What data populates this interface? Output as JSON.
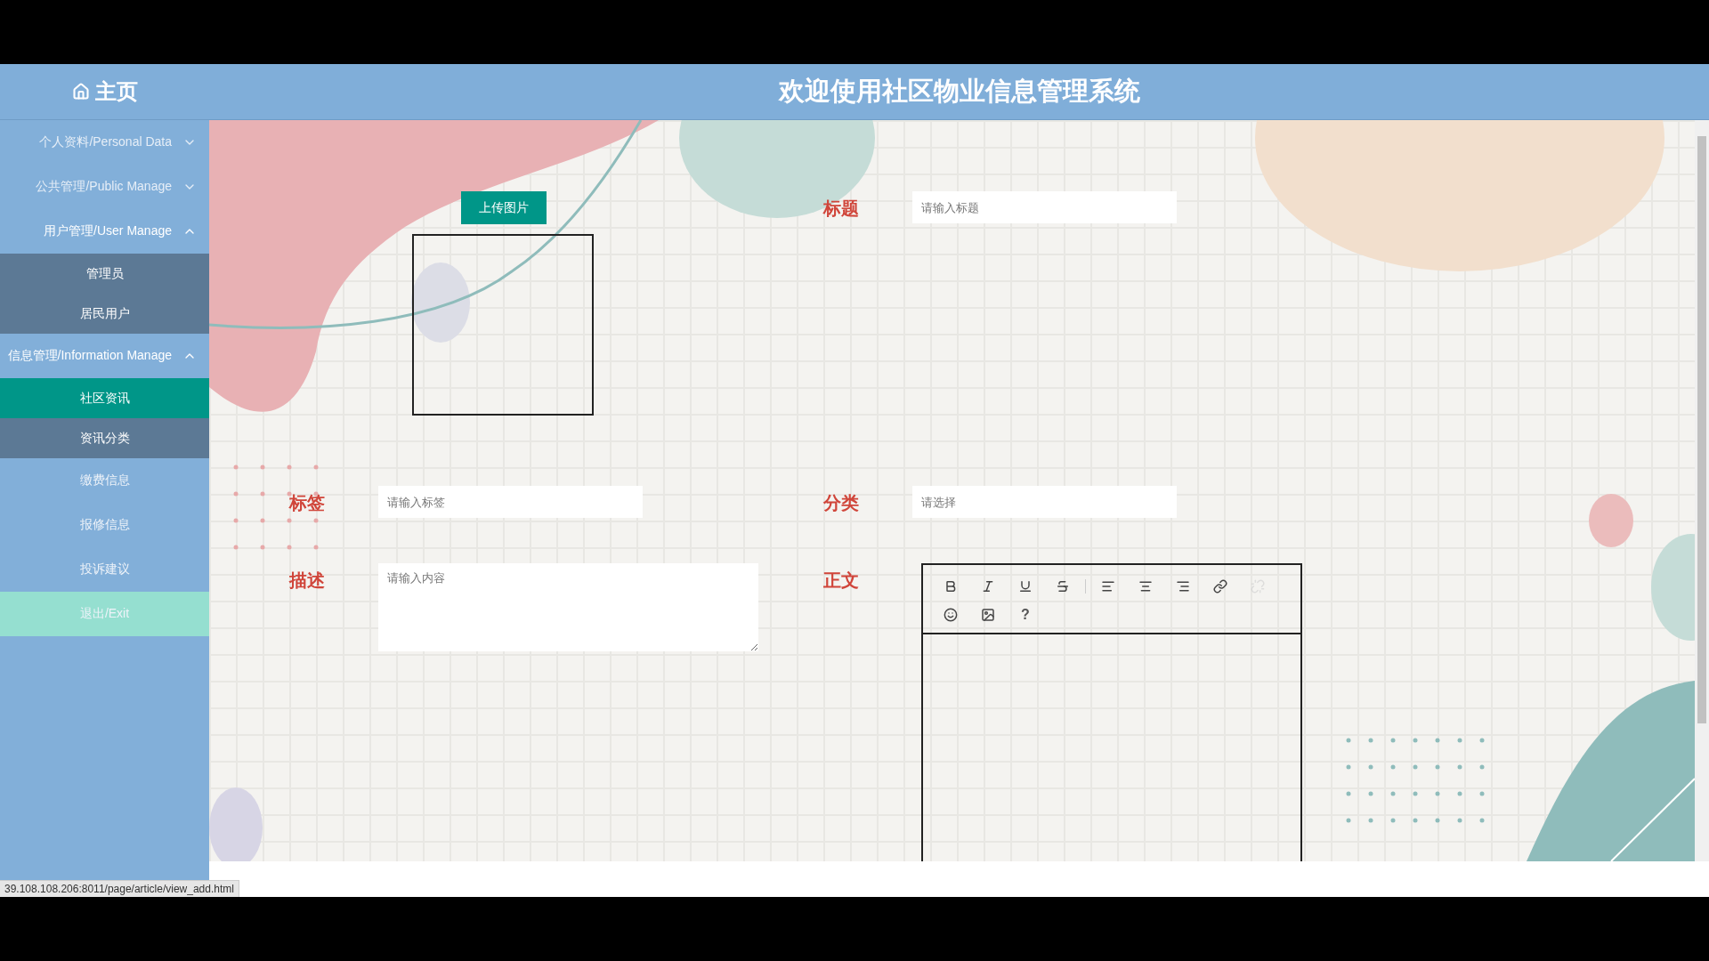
{
  "header": {
    "home": "主页",
    "title": "欢迎使用社区物业信息管理系统"
  },
  "sidebar": {
    "items": [
      {
        "label": "个人资料/Personal Data",
        "kind": "group",
        "expanded": false
      },
      {
        "label": "公共管理/Public Manage",
        "kind": "group",
        "expanded": false
      },
      {
        "label": "用户管理/User Manage",
        "kind": "group",
        "expanded": true,
        "children": [
          {
            "label": "管理员",
            "selected": false
          },
          {
            "label": "居民用户",
            "selected": false
          }
        ]
      },
      {
        "label": "信息管理/Information Manage",
        "kind": "group",
        "expanded": true,
        "children": [
          {
            "label": "社区资讯",
            "selected": true
          },
          {
            "label": "资讯分类",
            "selected": false
          }
        ]
      },
      {
        "label": "缴费信息",
        "kind": "link"
      },
      {
        "label": "报修信息",
        "kind": "link"
      },
      {
        "label": "投诉建议",
        "kind": "link"
      },
      {
        "label": "退出/Exit",
        "kind": "exit"
      }
    ]
  },
  "form": {
    "upload_button": "上传图片",
    "title": {
      "label": "标题",
      "placeholder": "请输入标题"
    },
    "tag": {
      "label": "标签",
      "placeholder": "请输入标签"
    },
    "category": {
      "label": "分类",
      "placeholder": "请选择"
    },
    "description": {
      "label": "描述",
      "placeholder": "请输入内容"
    },
    "body": {
      "label": "正文",
      "toolbar": [
        {
          "kind": "bold",
          "disabled": false
        },
        {
          "kind": "italic",
          "disabled": false
        },
        {
          "kind": "underline",
          "disabled": false
        },
        {
          "kind": "strike",
          "disabled": false
        },
        {
          "kind": "separator"
        },
        {
          "kind": "align-left",
          "disabled": false
        },
        {
          "kind": "align-center",
          "disabled": false
        },
        {
          "kind": "align-right",
          "disabled": false
        },
        {
          "kind": "link",
          "disabled": false
        },
        {
          "kind": "unlink",
          "disabled": true
        },
        {
          "kind": "break"
        },
        {
          "kind": "emoji",
          "disabled": false
        },
        {
          "kind": "image",
          "disabled": false
        },
        {
          "kind": "help",
          "label": "?",
          "disabled": false
        }
      ]
    }
  },
  "status_bar": {
    "url": "39.108.108.206:8011/page/article/view_add.html"
  }
}
